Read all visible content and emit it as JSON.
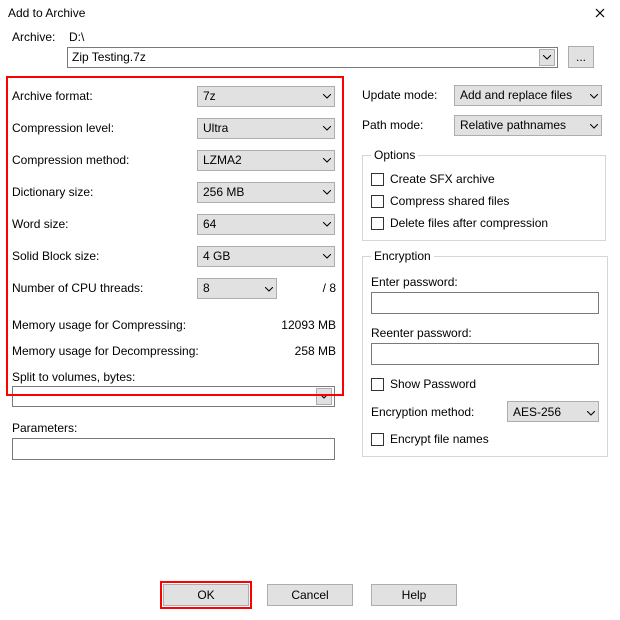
{
  "window": {
    "title": "Add to Archive"
  },
  "archive": {
    "label": "Archive:",
    "path": "D:\\",
    "filename": "Zip Testing.7z",
    "browse": "..."
  },
  "left": {
    "archive_format": {
      "label": "Archive format:",
      "value": "7z"
    },
    "compression_level": {
      "label": "Compression level:",
      "value": "Ultra"
    },
    "compression_method": {
      "label": "Compression method:",
      "value": "LZMA2"
    },
    "dictionary_size": {
      "label": "Dictionary size:",
      "value": "256 MB"
    },
    "word_size": {
      "label": "Word size:",
      "value": "64"
    },
    "solid_block_size": {
      "label": "Solid Block size:",
      "value": "4 GB"
    },
    "cpu_threads": {
      "label": "Number of CPU threads:",
      "value": "8",
      "max": "/ 8"
    },
    "mem_compress": {
      "label": "Memory usage for Compressing:",
      "value": "12093 MB"
    },
    "mem_decompress": {
      "label": "Memory usage for Decompressing:",
      "value": "258 MB"
    },
    "split": {
      "label": "Split to volumes, bytes:"
    },
    "parameters": {
      "label": "Parameters:"
    }
  },
  "right": {
    "update_mode": {
      "label": "Update mode:",
      "value": "Add and replace files"
    },
    "path_mode": {
      "label": "Path mode:",
      "value": "Relative pathnames"
    },
    "options": {
      "legend": "Options",
      "sfx": "Create SFX archive",
      "shared": "Compress shared files",
      "delete_after": "Delete files after compression"
    },
    "encryption": {
      "legend": "Encryption",
      "enter": "Enter password:",
      "reenter": "Reenter password:",
      "show": "Show Password",
      "method_label": "Encryption method:",
      "method_value": "AES-256",
      "encrypt_names": "Encrypt file names"
    }
  },
  "footer": {
    "ok": "OK",
    "cancel": "Cancel",
    "help": "Help"
  }
}
